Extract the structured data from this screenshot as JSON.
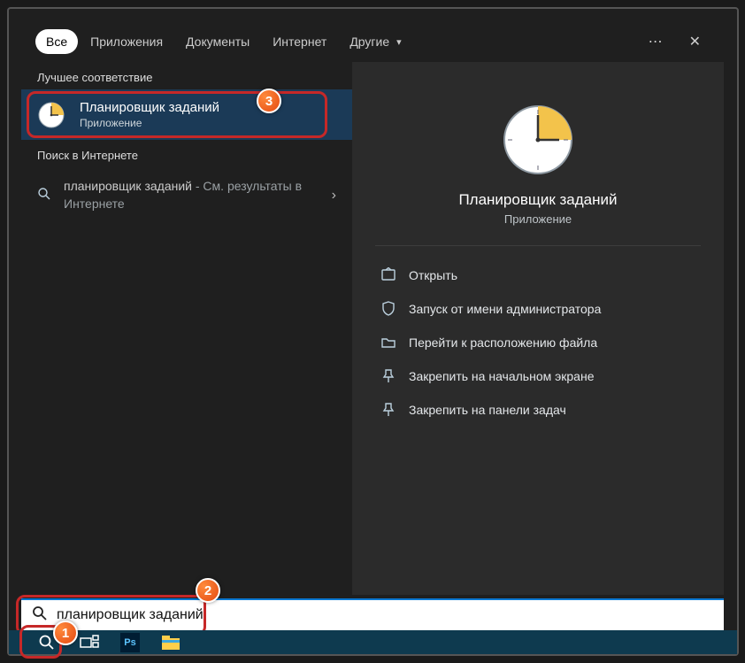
{
  "tabs": {
    "all": "Все",
    "apps": "Приложения",
    "docs": "Документы",
    "web": "Интернет",
    "other": "Другие"
  },
  "sections": {
    "best": "Лучшее соответствие",
    "web": "Поиск в Интернете"
  },
  "best": {
    "title": "Планировщик заданий",
    "sub": "Приложение"
  },
  "webresult": {
    "query": "планировщик заданий",
    "suffix": " - См. результаты в Интернете"
  },
  "detail": {
    "title": "Планировщик заданий",
    "sub": "Приложение"
  },
  "actions": {
    "open": "Открыть",
    "admin": "Запуск от имени администратора",
    "location": "Перейти к расположению файла",
    "pin_start": "Закрепить на начальном экране",
    "pin_task": "Закрепить на панели задач"
  },
  "search": {
    "value": "планировщик заданий"
  },
  "badges": {
    "b1": "1",
    "b2": "2",
    "b3": "3"
  }
}
